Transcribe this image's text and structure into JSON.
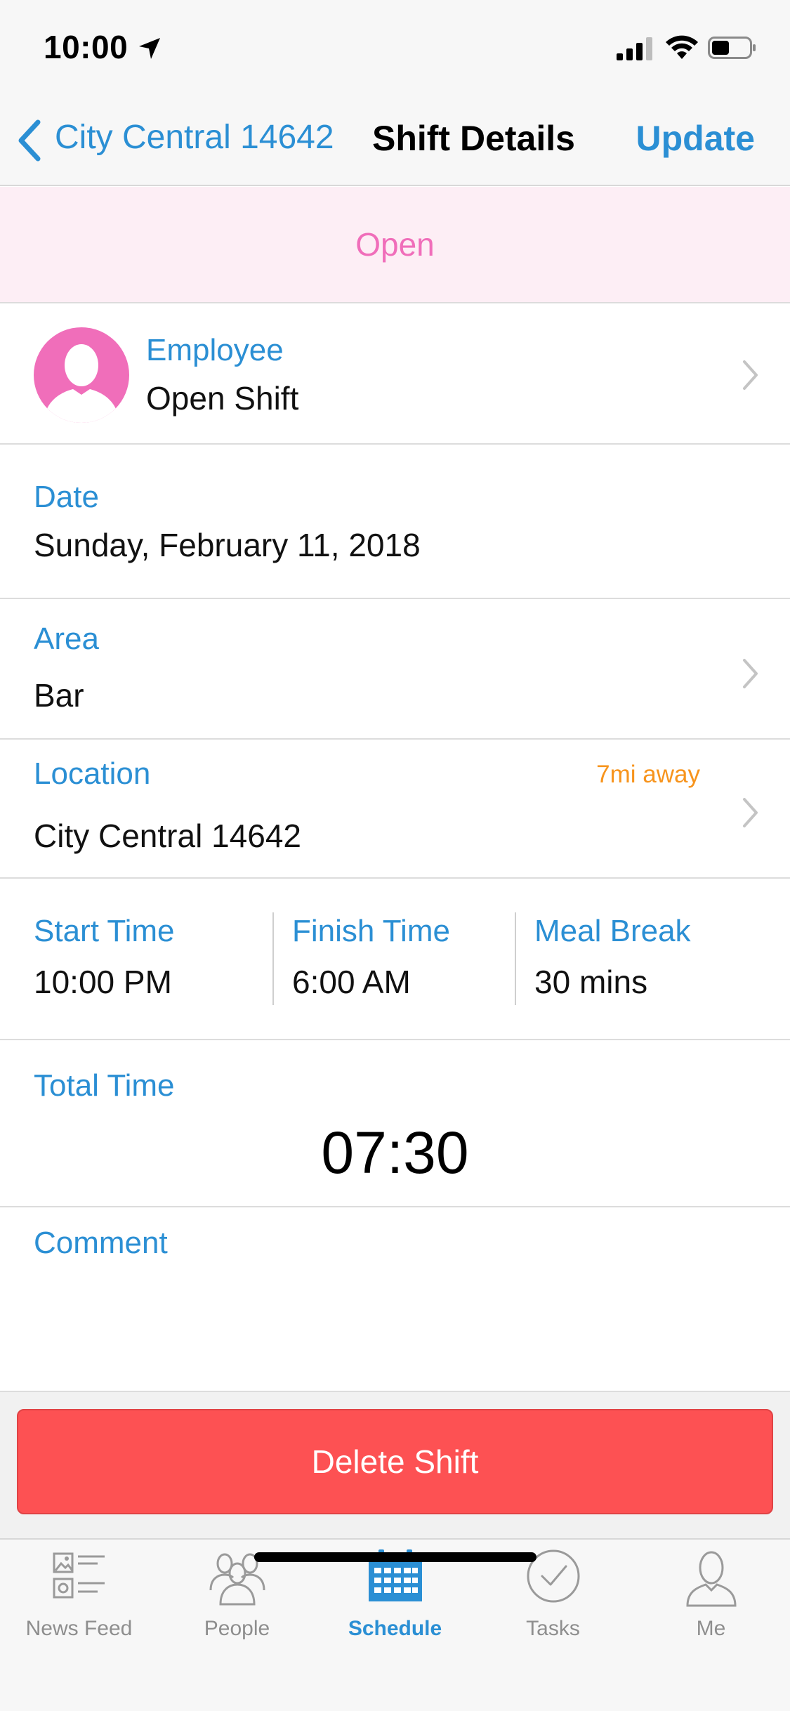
{
  "status_bar": {
    "time": "10:00"
  },
  "nav": {
    "back_label": "City Central 14642",
    "title": "Shift Details",
    "action_label": "Update"
  },
  "banner": {
    "status": "Open"
  },
  "employee": {
    "label": "Employee",
    "value": "Open Shift"
  },
  "date": {
    "label": "Date",
    "value": "Sunday, February 11, 2018"
  },
  "area": {
    "label": "Area",
    "value": "Bar"
  },
  "location": {
    "label": "Location",
    "value": "City Central 14642",
    "distance": "7mi away"
  },
  "times": {
    "start": {
      "label": "Start Time",
      "value": "10:00 PM"
    },
    "finish": {
      "label": "Finish Time",
      "value": "6:00 AM"
    },
    "meal": {
      "label": "Meal Break",
      "value": "30 mins"
    }
  },
  "total": {
    "label": "Total Time",
    "value": "07:30"
  },
  "comment": {
    "label": "Comment",
    "value": ""
  },
  "delete_button": {
    "label": "Delete Shift"
  },
  "tabs": [
    {
      "label": "News Feed",
      "icon": "news-feed-icon",
      "active": false
    },
    {
      "label": "People",
      "icon": "people-icon",
      "active": false
    },
    {
      "label": "Schedule",
      "icon": "calendar-icon",
      "active": true
    },
    {
      "label": "Tasks",
      "icon": "checkmark-circle-icon",
      "active": false
    },
    {
      "label": "Me",
      "icon": "person-icon",
      "active": false
    }
  ],
  "colors": {
    "accent": "#2b8fd4",
    "open_pink": "#f06eba",
    "banner_bg": "#fdeef5",
    "distance_orange": "#f7941d",
    "delete_red": "#fd5153"
  }
}
